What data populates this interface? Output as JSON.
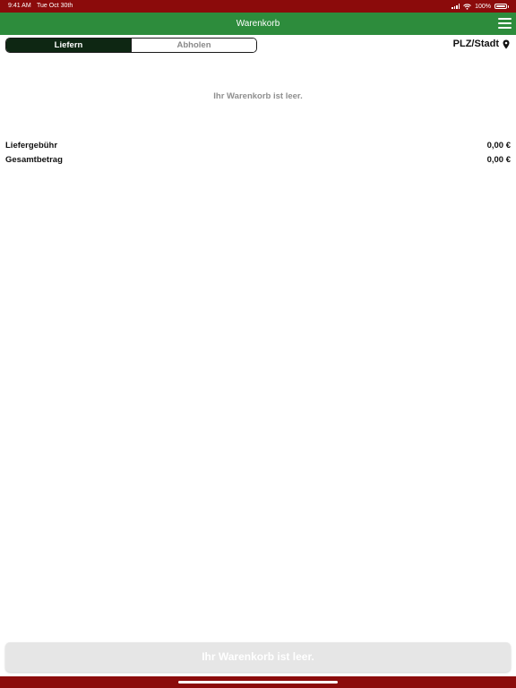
{
  "status_bar": {
    "time": "9:41 AM",
    "date": "Tue Oct 30th",
    "battery_percent": "100%",
    "battery_level": 1.0,
    "signal_icon": "cellular-signal-icon",
    "wifi_icon": "wifi-icon",
    "battery_icon": "battery-icon"
  },
  "nav": {
    "title": "Warenkorb",
    "menu_icon": "hamburger-menu-icon"
  },
  "order_type": {
    "options": [
      "Liefern",
      "Abholen"
    ],
    "selected": "Liefern"
  },
  "location": {
    "label": "PLZ/Stadt",
    "icon": "map-pin-icon"
  },
  "cart": {
    "empty_message": "Ihr Warenkorb ist leer."
  },
  "summary": {
    "delivery_fee_label": "Liefergebühr",
    "delivery_fee_value": "0,00 €",
    "total_label": "Gesamtbetrag",
    "total_value": "0,00 €"
  },
  "checkout": {
    "label": "Ihr Warenkorb ist leer."
  },
  "colors": {
    "status_bar": "#8b0b0b",
    "nav_bar": "#2d8c3c",
    "segment_active": "#0e2713",
    "muted_text": "#8f8f8f",
    "button_disabled": "#e6e6e6"
  }
}
